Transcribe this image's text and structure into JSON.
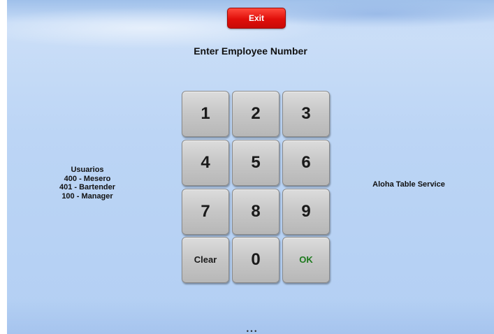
{
  "header": {
    "exit_label": "Exit"
  },
  "title": "Enter Employee Number",
  "users_info": {
    "heading": "Usuarios",
    "lines": [
      "400 - Mesero",
      "401 - Bartender",
      "100 - Manager"
    ]
  },
  "product_name": "Aloha Table Service",
  "keypad": {
    "keys": [
      "1",
      "2",
      "3",
      "4",
      "5",
      "6",
      "7",
      "8",
      "9",
      "Clear",
      "0",
      "OK"
    ]
  },
  "footer": {
    "indicator": "• • •"
  },
  "colors": {
    "exit_button": "#e00f0a",
    "ok_text": "#1d7a1d",
    "background": "#bcd5f5",
    "key_face": "#c6c6c6"
  },
  "icons": {
    "footer_indicator": "ellipsis-icon"
  }
}
